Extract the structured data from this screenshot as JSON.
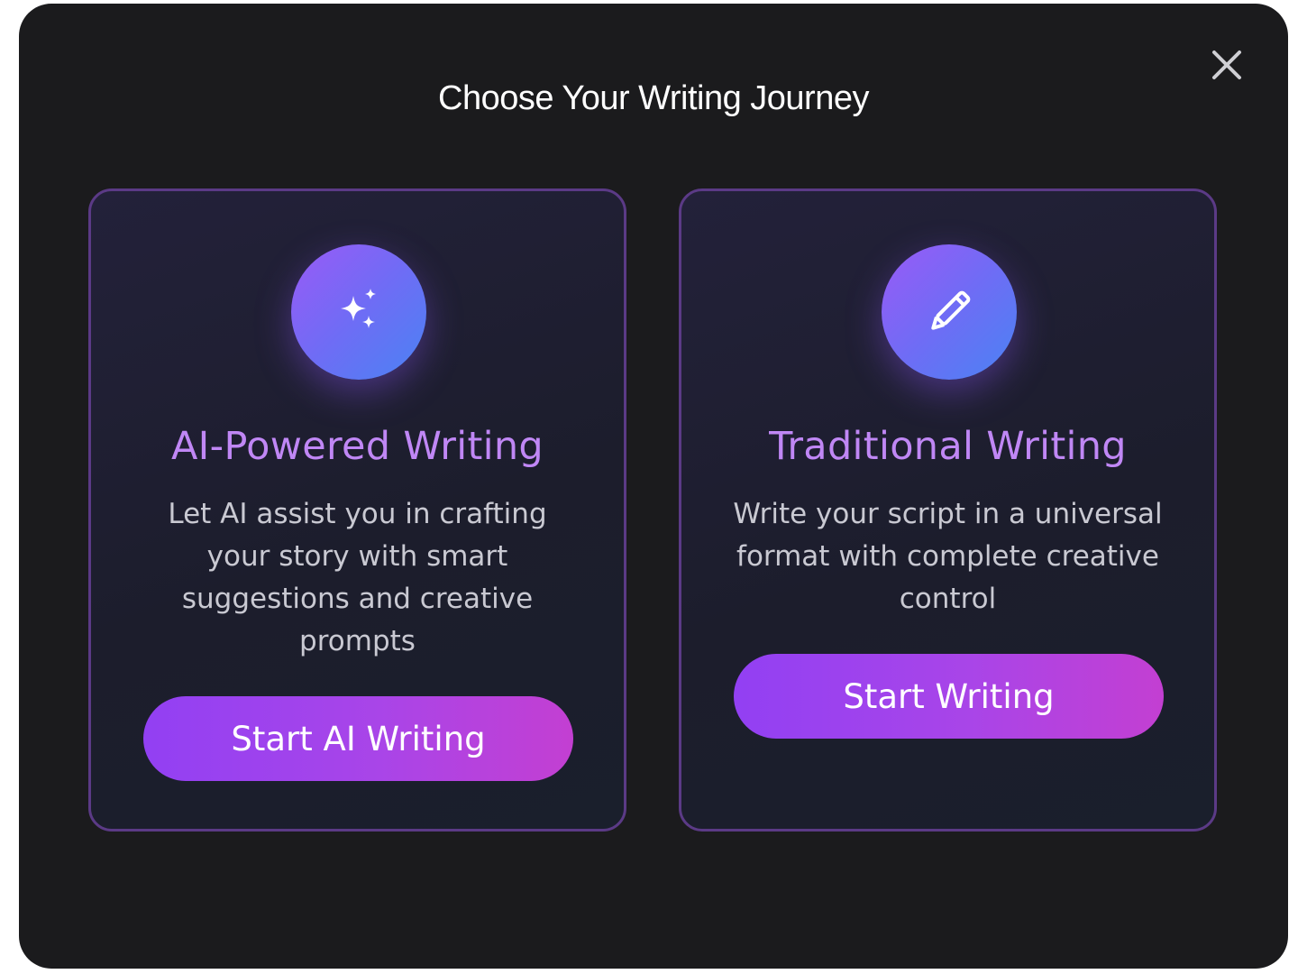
{
  "modal": {
    "title": "Choose Your Writing Journey",
    "close_icon": "close-icon"
  },
  "cards": [
    {
      "icon": "sparkles-icon",
      "title": "AI-Powered Writing",
      "description": "Let AI assist you in crafting your story with smart suggestions and creative prompts",
      "button_label": "Start AI Writing"
    },
    {
      "icon": "pencil-icon",
      "title": "Traditional Writing",
      "description": "Write your script in a universal format with complete creative control",
      "button_label": "Start Writing"
    }
  ],
  "colors": {
    "modal_background": "#1b1b1d",
    "card_border": "#5b3a86",
    "card_title": "#c087f5",
    "button_gradient_start": "#9240f3",
    "button_gradient_end": "#c33fd2",
    "icon_gradient_start": "#9a5af6",
    "icon_gradient_end": "#4a83f3"
  }
}
